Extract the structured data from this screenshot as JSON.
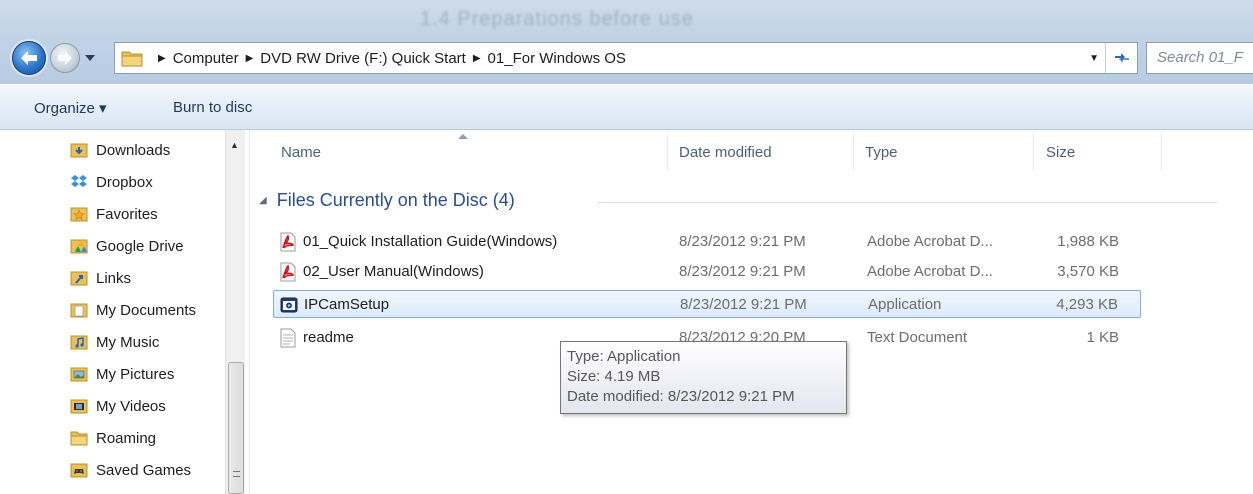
{
  "window": {
    "title": "1.4 Preparations before use"
  },
  "address_bar": {
    "crumbs": [
      "Computer",
      "DVD RW Drive (F:) Quick Start",
      "01_For Windows OS"
    ]
  },
  "search": {
    "placeholder": "Search 01_F"
  },
  "toolbar": {
    "organize_label": "Organize ▾",
    "burn_label": "Burn to disc"
  },
  "nav_pane": {
    "items": [
      {
        "label": "Downloads",
        "icon": "downloads-folder-icon"
      },
      {
        "label": "Dropbox",
        "icon": "dropbox-icon"
      },
      {
        "label": "Favorites",
        "icon": "favorites-folder-icon"
      },
      {
        "label": "Google Drive",
        "icon": "google-drive-icon"
      },
      {
        "label": "Links",
        "icon": "links-folder-icon"
      },
      {
        "label": "My Documents",
        "icon": "documents-folder-icon"
      },
      {
        "label": "My Music",
        "icon": "music-folder-icon"
      },
      {
        "label": "My Pictures",
        "icon": "pictures-folder-icon"
      },
      {
        "label": "My Videos",
        "icon": "videos-folder-icon"
      },
      {
        "label": "Roaming",
        "icon": "folder-icon"
      },
      {
        "label": "Saved Games",
        "icon": "saved-games-folder-icon"
      }
    ]
  },
  "columns": {
    "name": "Name",
    "date": "Date modified",
    "type": "Type",
    "size": "Size"
  },
  "group": {
    "label": "Files Currently on the Disc (4)"
  },
  "files": [
    {
      "name": "01_Quick Installation Guide(Windows)",
      "date": "8/23/2012 9:21 PM",
      "type": "Adobe Acrobat D...",
      "size": "1,988 KB",
      "icon": "pdf-file-icon"
    },
    {
      "name": "02_User Manual(Windows)",
      "date": "8/23/2012 9:21 PM",
      "type": "Adobe Acrobat D...",
      "size": "3,570 KB",
      "icon": "pdf-file-icon"
    },
    {
      "name": "IPCamSetup",
      "date": "8/23/2012 9:21 PM",
      "type": "Application",
      "size": "4,293 KB",
      "icon": "application-icon",
      "selected": true
    },
    {
      "name": "readme",
      "date": "8/23/2012 9:20 PM",
      "type": "Text Document",
      "size": "1 KB",
      "icon": "text-file-icon"
    }
  ],
  "tooltip": {
    "type_line": "Type: Application",
    "size_line": "Size: 4.19 MB",
    "date_line": "Date modified: 8/23/2012 9:21 PM"
  },
  "colors": {
    "accent": "#2a4d8f",
    "selection_border": "#84acdd",
    "toolbar_text": "#1e395b"
  }
}
